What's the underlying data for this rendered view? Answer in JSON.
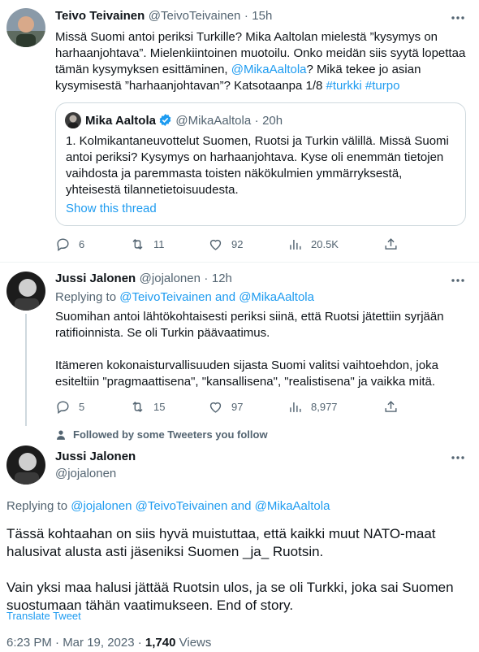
{
  "tweet1": {
    "name": "Teivo Teivainen",
    "handle": "@TeivoTeivainen",
    "sep": "·",
    "time": "15h",
    "text_a": "Missä Suomi antoi periksi Turkille? Mika Aaltolan mielestä ”kysymys on harhaanjohtava”. Mielenkiintoinen muotoilu. Onko meidän siis syytä lopettaa tämän kysymyksen esittäminen, ",
    "mention": "@MikaAaltola",
    "text_b": "? Mikä tekee jo asian kysymisestä ”harhaanjohtavan”? Katsotaanpa 1/8 ",
    "hashtag1": "#turkki",
    "hashtag2": "#turpo",
    "quote": {
      "name": "Mika Aaltola",
      "handle": "@MikaAaltola",
      "sep": "·",
      "time": "20h",
      "text": "1. Kolmikantaneuvottelut Suomen, Ruotsi ja Turkin välillä. Missä Suomi antoi periksi? Kysymys on harhaanjohtava. Kyse oli enemmän tietojen vaihdosta ja paremmasta toisten näkökulmien ymmärryksestä, yhteisestä tilannetietoisuudesta.",
      "show_thread": "Show this thread"
    },
    "stats": {
      "replies": "6",
      "retweets": "11",
      "likes": "92",
      "views": "20.5K"
    }
  },
  "tweet2": {
    "name": "Jussi Jalonen",
    "handle": "@jojalonen",
    "sep": "·",
    "time": "12h",
    "replying_prefix": "Replying to ",
    "replying_to": "@TeivoTeivainen and @MikaAaltola",
    "para1": "Suomihan antoi lähtökohtaisesti periksi siinä, että Ruotsi jätettiin syrjään ratifioinnista. Se oli Turkin päävaatimus.",
    "para2": "Itämeren kokonaisturvallisuuden sijasta Suomi valitsi vaihtoehdon, joka esiteltiin \"pragmaattisena\", \"kansallisena\", \"realistisena\" ja vaikka mitä.",
    "stats": {
      "replies": "5",
      "retweets": "15",
      "likes": "97",
      "views": "8,977"
    }
  },
  "followed_note": "Followed by some Tweeters you follow",
  "main": {
    "name": "Jussi Jalonen",
    "handle": "@jojalonen",
    "replying_prefix": "Replying to ",
    "replying_to": "@jojalonen @TeivoTeivainen and @MikaAaltola",
    "para1": "Tässä kohtaahan on siis hyvä muistuttaa, että kaikki muut NATO-maat halusivat alusta asti jäseniksi Suomen _ja_ Ruotsin.",
    "para2": "Vain yksi maa halusi jättää Ruotsin ulos, ja se oli Turkki, joka sai Suomen suostumaan tähän vaatimukseen. End of story.",
    "translate": "Translate Tweet",
    "timestamp": "6:23 PM · Mar 19, 2023 · ",
    "views_count": "1,740",
    "views_label": " Views"
  },
  "colors": {
    "link": "#1d9bf0",
    "muted": "#536471",
    "text": "#0f1419",
    "border": "#cfd9de"
  },
  "icons": [
    "reply-icon",
    "retweet-icon",
    "like-icon",
    "views-icon",
    "share-icon",
    "more-icon",
    "verified-icon",
    "person-icon"
  ]
}
